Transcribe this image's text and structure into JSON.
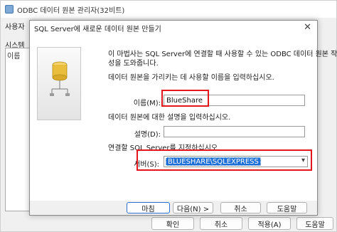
{
  "parent_window": {
    "title": "ODBC 데이터 원본 관리자(32비트)",
    "tab_prefix": "사용자",
    "list_label": "시스템",
    "list_header": "이름",
    "buttons": {
      "ok": "확인",
      "cancel": "취소",
      "apply": "적용(A)",
      "help": "도움말"
    }
  },
  "dialog": {
    "title": "SQL Server에 새로운 데이터 원본 만들기",
    "close_glyph": "✕",
    "intro_line1": "이 마법사는 SQL Server에 연결할 때 사용할 수 있는 ODBC 데이터 원본 작",
    "intro_line2": "성을 도와줍니다.",
    "name_prompt": "데이터 원본을 가리키는 데 사용할 이름을 입력하십시오.",
    "name_label": "이름(M):",
    "name_value": "BlueShare",
    "desc_prompt": "데이터 원본에 대한 설명을 입력하십시오.",
    "desc_label": "설명(D):",
    "desc_value": "",
    "server_prompt": "연결할 SQL Server를 지정하십시오.",
    "server_label": "서버(S):",
    "server_value": "BLUESHARE\\SQLEXPRESS",
    "buttons": {
      "finish": "마침",
      "next": "다음(N) >",
      "cancel": "취소",
      "help": "도움말"
    }
  },
  "colors": {
    "highlight_red": "#e3171b",
    "selection_blue": "#1e6fd6"
  },
  "icons": [
    "database-server-icon",
    "close-icon",
    "chevron-down-icon"
  ]
}
